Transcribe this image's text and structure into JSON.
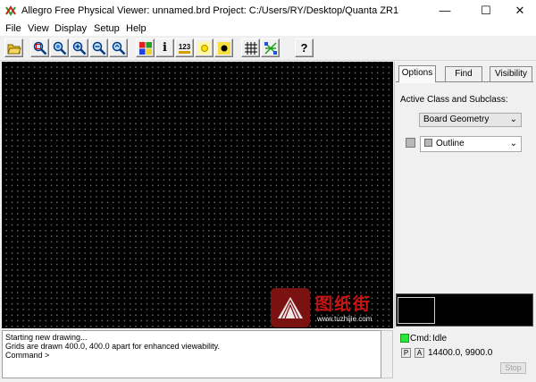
{
  "window": {
    "title": "Allegro Free Physical Viewer: unnamed.brd  Project: C:/Users/RY/Desktop/Quanta ZR1",
    "icon": "allegro-app-icon",
    "controls": {
      "minimize": "—",
      "maximize": "☐",
      "close": "✕"
    }
  },
  "menu": [
    "File",
    "View",
    "Display",
    "Setup",
    "Help"
  ],
  "toolbar": {
    "buttons": [
      {
        "name": "open-icon"
      },
      {
        "name": "zoom-points-icon"
      },
      {
        "name": "zoom-fit-icon"
      },
      {
        "name": "zoom-in-icon"
      },
      {
        "name": "zoom-out-icon"
      },
      {
        "name": "zoom-previous-icon"
      },
      {
        "name": "color-icon"
      },
      {
        "name": "info-icon",
        "glyph": "i"
      },
      {
        "name": "measure-icon",
        "glyph": "123"
      },
      {
        "name": "highlight-icon"
      },
      {
        "name": "dehighlight-icon"
      },
      {
        "name": "grid-icon"
      },
      {
        "name": "ratsnest-icon"
      },
      {
        "name": "help-icon",
        "glyph": "?"
      }
    ]
  },
  "side_panel": {
    "tabs": [
      "Options",
      "Find",
      "Visibility"
    ],
    "active_tab": "Options",
    "active_label": "Active Class and Subclass:",
    "class_value": "Board Geometry",
    "subclass_value": "Outline"
  },
  "watermark": {
    "text": "图纸街",
    "url": "www.tuzhijie.com"
  },
  "console": {
    "lines": [
      "Starting new drawing...",
      "Grids are drawn 400.0, 400.0 apart for enhanced viewability.",
      "Command >"
    ]
  },
  "status": {
    "cmd_label": "Cmd:",
    "cmd_state": "Idle",
    "p_label": "P",
    "a_label": "A",
    "coordinates": "14400.0, 9900.0",
    "stop_label": "Stop"
  },
  "colors": {
    "canvas": "#000000",
    "grid_dot": "#7a7a7a",
    "cmd_indicator": "#29e63a",
    "watermark_red": "#c81414"
  }
}
